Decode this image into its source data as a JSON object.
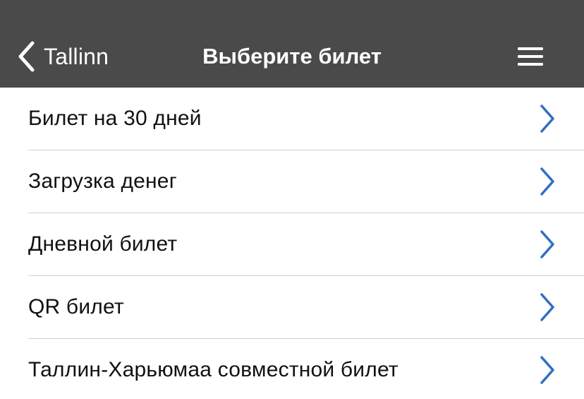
{
  "navbar": {
    "back_label": "Tallinn",
    "title": "Выберите билет",
    "back_icon": "chevron-left-icon",
    "menu_icon": "hamburger-menu-icon",
    "background_color": "#4a4a4a"
  },
  "list": {
    "chevron_icon": "chevron-right-icon",
    "chevron_color": "#2f6fc2",
    "items": [
      {
        "label": "Билет на 30 дней"
      },
      {
        "label": "Загрузка денег"
      },
      {
        "label": "Дневной билет"
      },
      {
        "label": "QR билет"
      },
      {
        "label": "Таллин-Харьюмаа совместной билет"
      }
    ]
  }
}
